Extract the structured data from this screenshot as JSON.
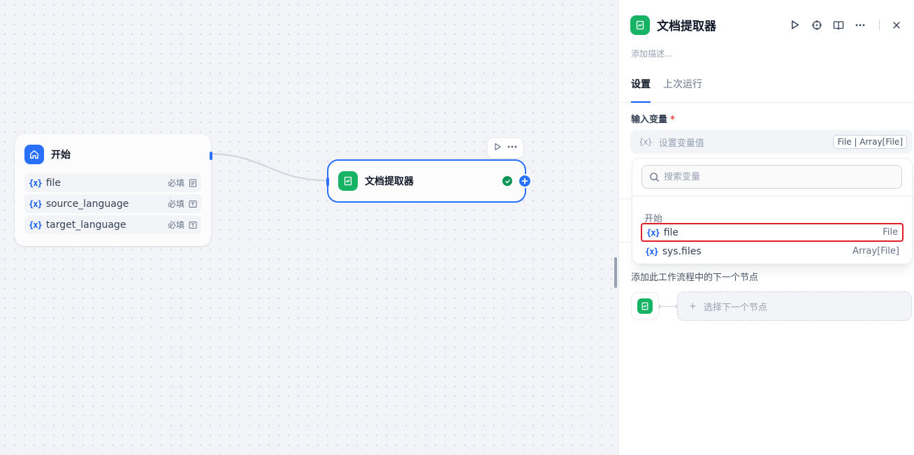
{
  "canvas": {
    "start_node": {
      "title": "开始",
      "icon": "home-icon",
      "variables": [
        {
          "name": "file",
          "required": "必填",
          "type_icon": "file-doc-icon"
        },
        {
          "name": "source_language",
          "required": "必填",
          "type_icon": "text-input-icon"
        },
        {
          "name": "target_language",
          "required": "必填",
          "type_icon": "text-input-icon"
        }
      ]
    },
    "doc_node": {
      "title": "文档提取器",
      "status": "success",
      "icon": "doc-extractor-icon"
    },
    "var_icon_text": "{x}"
  },
  "panel": {
    "title": "文档提取器",
    "description_placeholder": "添加描述...",
    "tabs": [
      {
        "label": "设置",
        "active": true
      },
      {
        "label": "上次运行",
        "active": false
      }
    ],
    "input_label": "输入变量",
    "required_mark": "*",
    "input_placeholder_icon": "{x}",
    "input_placeholder": "设置变量值",
    "type_tag": "File | Array[File]",
    "dropdown": {
      "search_placeholder": "搜索变量",
      "group": "开始",
      "items": [
        {
          "name": "file",
          "type": "File",
          "selected": true
        },
        {
          "name": "sys.files",
          "type": "Array[File]",
          "selected": false
        }
      ]
    },
    "next_step_desc": "添加此工作流程中的下一个节点",
    "next_step_button": "选择下一个节点",
    "next_step_plus": "+"
  },
  "colors": {
    "accent": "#2970ff",
    "node_green": "#16b364",
    "highlight_red": "#e11d2a"
  }
}
